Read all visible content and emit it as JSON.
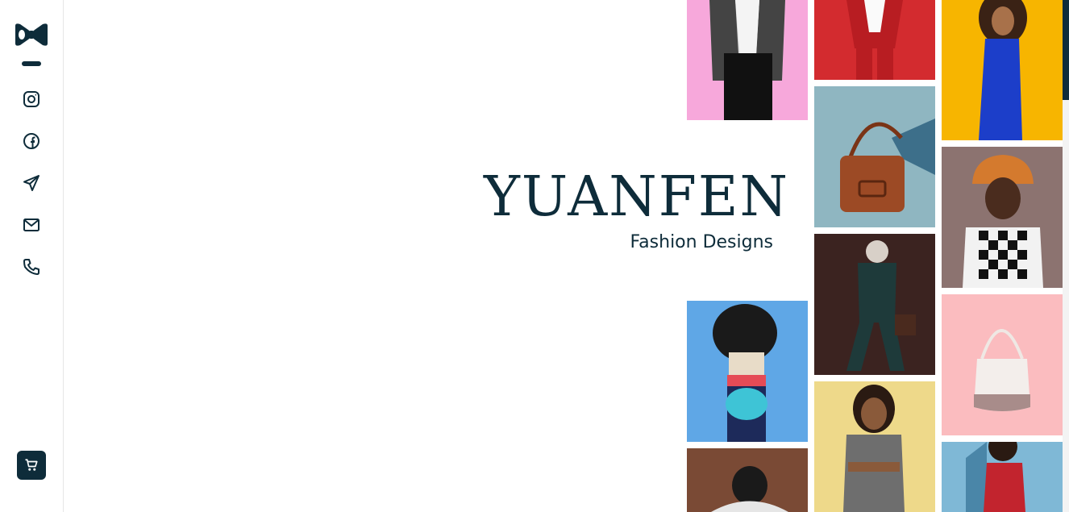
{
  "brand": {
    "title": "YUANFEN",
    "subtitle": "Fashion Designs"
  },
  "sidebar": {
    "logo_icon": "bowtie-logo-icon",
    "social_links": [
      {
        "name": "instagram",
        "icon": "instagram-icon"
      },
      {
        "name": "facebook",
        "icon": "facebook-icon"
      },
      {
        "name": "telegram",
        "icon": "telegram-icon"
      },
      {
        "name": "email",
        "icon": "mail-icon"
      },
      {
        "name": "phone",
        "icon": "phone-icon"
      }
    ],
    "cart_icon": "cart-icon"
  },
  "gallery": [
    {
      "name": "woman-houndstooth-jacket",
      "background": "#f7a8db"
    },
    {
      "name": "man-red-suit",
      "background": "#d32b2f"
    },
    {
      "name": "woman-blue-dress",
      "background": "#f7b500"
    },
    {
      "name": "brown-leather-bag",
      "background": "#8fb6c1"
    },
    {
      "name": "man-orange-bucket-hat",
      "background": "#8c7370"
    },
    {
      "name": "man-dark-suit",
      "background": "#3b2320"
    },
    {
      "name": "white-bucket-bag",
      "background": "#fbbcbf"
    },
    {
      "name": "woman-turquoise-bag",
      "background": "#5fa7e6"
    },
    {
      "name": "woman-grey-dress",
      "background": "#eed98a"
    },
    {
      "name": "man-white-shirt-back",
      "background": "#7a4a35"
    },
    {
      "name": "woman-red-dress",
      "background": "#7fb8d6"
    }
  ],
  "theme": {
    "primary": "#0e2c3a",
    "background": "#ffffff"
  }
}
